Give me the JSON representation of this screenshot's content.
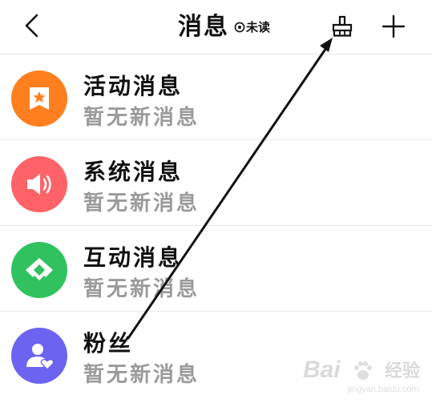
{
  "header": {
    "title": "消息",
    "unread_label": "未读",
    "icons": {
      "back": "chevron-left-icon",
      "unread": "target-icon",
      "clear": "broom-icon",
      "add": "plus-icon"
    }
  },
  "messages": [
    {
      "title": "活动消息",
      "subtitle": "暂无新消息",
      "icon": "bookmark-star-icon",
      "color": "#FF7F1E"
    },
    {
      "title": "系统消息",
      "subtitle": "暂无新消息",
      "icon": "speaker-icon",
      "color": "#FF6368"
    },
    {
      "title": "互动消息",
      "subtitle": "暂无新消息",
      "icon": "handshake-icon",
      "color": "#30C25E"
    },
    {
      "title": "粉丝",
      "subtitle": "暂无新消息",
      "icon": "user-heart-icon",
      "color": "#6C63F0"
    }
  ],
  "watermark": {
    "brand": "Bai",
    "brand_cn": "经验",
    "url": "jingyan.baidu.com"
  }
}
